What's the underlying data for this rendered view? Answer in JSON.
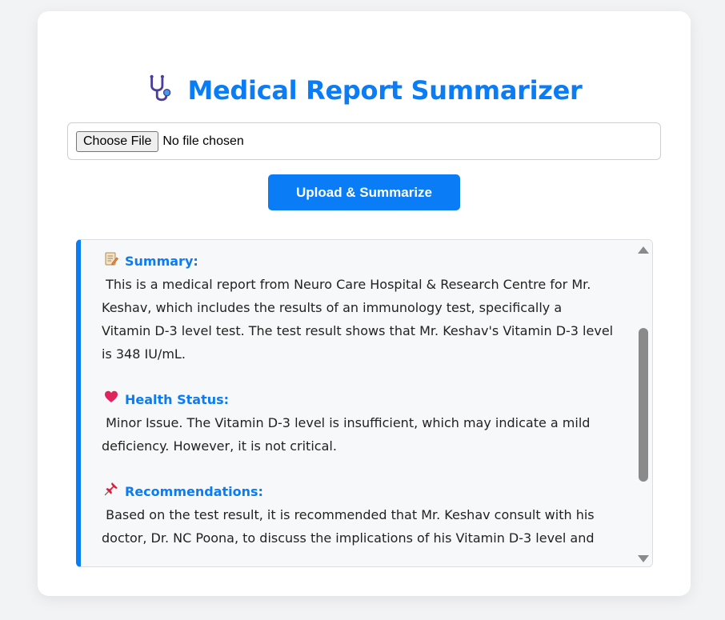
{
  "app": {
    "title": "Medical Report Summarizer"
  },
  "upload": {
    "choose_file_label": "Choose File",
    "file_status": "No file chosen",
    "submit_label": "Upload & Summarize"
  },
  "result": {
    "sections": [
      {
        "icon": "memo-icon",
        "heading": "Summary:",
        "body": " This is a medical report from Neuro Care Hospital & Research Centre for Mr. Keshav, which includes the results of an immunology test, specifically a Vitamin D-3 level test. The test result shows that Mr. Keshav's Vitamin D-3 level is 348 IU/mL."
      },
      {
        "icon": "heart-icon",
        "heading": "Health Status:",
        "body": " Minor Issue. The Vitamin D-3 level is insufficient, which may indicate a mild deficiency. However, it is not critical."
      },
      {
        "icon": "pushpin-icon",
        "heading": "Recommendations:",
        "body": " Based on the test result, it is recommended that Mr. Keshav consult with his doctor, Dr. NC Poona, to discuss the implications of his Vitamin D-3 level and"
      }
    ]
  },
  "colors": {
    "accent": "#0a7cf5",
    "heart": "#e0245e",
    "pin": "#d81e3c"
  }
}
